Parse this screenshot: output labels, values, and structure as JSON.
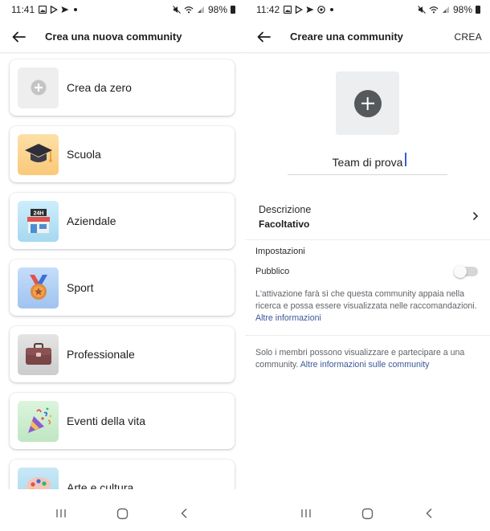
{
  "left_screen": {
    "status": {
      "time": "11:41",
      "battery": "98%"
    },
    "header": {
      "title": "Crea una nuova community"
    },
    "options": [
      {
        "label": "Crea da zero",
        "icon": "plus-icon",
        "bg": "#eeeeee"
      },
      {
        "label": "Scuola",
        "icon": "graduation-cap-icon",
        "bg": "#fbd38d"
      },
      {
        "label": "Aziendale",
        "icon": "store-24h-icon",
        "bg": "#b9e3f5"
      },
      {
        "label": "Sport",
        "icon": "medal-icon",
        "bg": "#b6d3f7"
      },
      {
        "label": "Professionale",
        "icon": "briefcase-icon",
        "bg": "#d8d8d8"
      },
      {
        "label": "Eventi della vita",
        "icon": "party-popper-icon",
        "bg": "#cdeecf"
      },
      {
        "label": "Arte e cultura",
        "icon": "palette-icon",
        "bg": "#b8def2"
      }
    ]
  },
  "right_screen": {
    "status": {
      "time": "11:42",
      "battery": "98%"
    },
    "header": {
      "title": "Creare una community",
      "action": "CREA"
    },
    "name_value": "Team di prova",
    "description": {
      "label": "Descrizione",
      "value": "Facoltativo"
    },
    "settings": {
      "heading": "Impostazioni",
      "public_label": "Pubblico",
      "public_enabled": false,
      "public_note": "L'attivazione farà sì che questa community appaia nella ricerca e possa essere visualizzata nelle raccomandazioni.",
      "public_link": "Altre informazioni"
    },
    "members_note": "Solo i membri possono visualizzare e partecipare a una community.",
    "members_link": "Altre informazioni sulle community"
  },
  "colors": {
    "link": "#3b5998",
    "caret": "#3b5bdb",
    "plus_circle": "#55595c"
  }
}
